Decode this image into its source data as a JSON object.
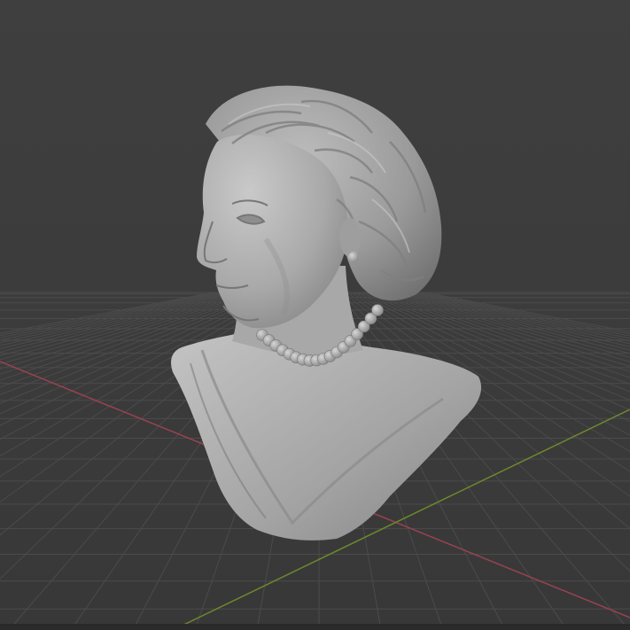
{
  "viewport": {
    "background_color": "#3d3d3d",
    "grid_color": "#4a4a4a",
    "x_axis_color": "#9a4250",
    "y_axis_color": "#6c8a2c",
    "model": "female-portrait-bust"
  }
}
